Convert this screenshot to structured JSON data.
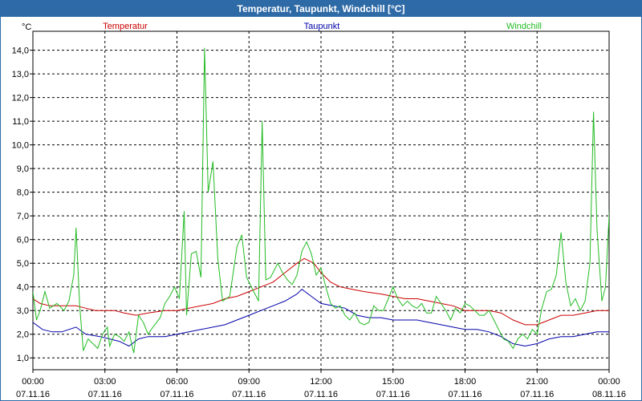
{
  "window": {
    "title": "Temperatur, Taupunkt, Windchill [°C]"
  },
  "colors": {
    "title_bg": "#2e6aa6",
    "temperatur": "#cc0000",
    "taupunkt": "#0000aa",
    "windchill": "#22bb22"
  },
  "chart_data": {
    "type": "line",
    "title": "Temperatur, Taupunkt, Windchill [°C]",
    "ylabel": "°C",
    "ylim": [
      0.5,
      14.8
    ],
    "xlim": [
      0,
      24
    ],
    "grid": true,
    "legend_placement": "top",
    "y_ticks": [
      {
        "value": 1,
        "label": "1,0"
      },
      {
        "value": 2,
        "label": "2,0"
      },
      {
        "value": 3,
        "label": "3,0"
      },
      {
        "value": 4,
        "label": "4,0"
      },
      {
        "value": 5,
        "label": "5,0"
      },
      {
        "value": 6,
        "label": "6,0"
      },
      {
        "value": 7,
        "label": "7,0"
      },
      {
        "value": 8,
        "label": "8,0"
      },
      {
        "value": 9,
        "label": "9,0"
      },
      {
        "value": 10,
        "label": "10,0"
      },
      {
        "value": 11,
        "label": "11,0"
      },
      {
        "value": 12,
        "label": "12,0"
      },
      {
        "value": 13,
        "label": "13,0"
      },
      {
        "value": 14,
        "label": "14,0"
      }
    ],
    "x_ticks": [
      {
        "value": 0,
        "time": "00:00",
        "date": "07.11.16"
      },
      {
        "value": 3,
        "time": "03:00",
        "date": "07.11.16"
      },
      {
        "value": 6,
        "time": "06:00",
        "date": "07.11.16"
      },
      {
        "value": 9,
        "time": "09:00",
        "date": "07.11.16"
      },
      {
        "value": 12,
        "time": "12:00",
        "date": "07.11.16"
      },
      {
        "value": 15,
        "time": "15:00",
        "date": "07.11.16"
      },
      {
        "value": 18,
        "time": "18:00",
        "date": "07.11.16"
      },
      {
        "value": 21,
        "time": "21:00",
        "date": "07.11.16"
      },
      {
        "value": 24,
        "time": "00:00",
        "date": "08.11.16"
      }
    ],
    "series": [
      {
        "name": "Temperatur",
        "color": "#cc0000",
        "points": [
          [
            0,
            3.5
          ],
          [
            0.3,
            3.3
          ],
          [
            0.7,
            3.2
          ],
          [
            1.2,
            3.2
          ],
          [
            1.8,
            3.2
          ],
          [
            2.2,
            3.1
          ],
          [
            2.6,
            3.0
          ],
          [
            3.0,
            3.0
          ],
          [
            3.4,
            3.0
          ],
          [
            3.8,
            2.9
          ],
          [
            4.3,
            2.8
          ],
          [
            4.8,
            2.9
          ],
          [
            5.5,
            3.0
          ],
          [
            6.0,
            3.0
          ],
          [
            6.5,
            3.1
          ],
          [
            7.0,
            3.2
          ],
          [
            7.5,
            3.3
          ],
          [
            8.0,
            3.5
          ],
          [
            8.5,
            3.6
          ],
          [
            9.0,
            3.8
          ],
          [
            9.5,
            4.0
          ],
          [
            10.0,
            4.2
          ],
          [
            10.5,
            4.6
          ],
          [
            11.0,
            5.0
          ],
          [
            11.3,
            5.2
          ],
          [
            11.7,
            5.0
          ],
          [
            12.0,
            4.6
          ],
          [
            12.4,
            4.2
          ],
          [
            12.8,
            4.0
          ],
          [
            13.3,
            3.9
          ],
          [
            13.8,
            3.8
          ],
          [
            14.5,
            3.7
          ],
          [
            15.0,
            3.6
          ],
          [
            15.5,
            3.5
          ],
          [
            16.0,
            3.5
          ],
          [
            16.5,
            3.4
          ],
          [
            17.0,
            3.3
          ],
          [
            17.5,
            3.2
          ],
          [
            18.0,
            3.0
          ],
          [
            18.5,
            3.0
          ],
          [
            19.0,
            3.0
          ],
          [
            19.5,
            2.9
          ],
          [
            20.0,
            2.6
          ],
          [
            20.5,
            2.4
          ],
          [
            21.0,
            2.4
          ],
          [
            21.5,
            2.6
          ],
          [
            22.0,
            2.8
          ],
          [
            22.5,
            2.8
          ],
          [
            23.0,
            2.9
          ],
          [
            23.5,
            3.0
          ],
          [
            24.0,
            3.0
          ]
        ]
      },
      {
        "name": "Taupunkt",
        "color": "#0000aa",
        "points": [
          [
            0,
            2.5
          ],
          [
            0.4,
            2.2
          ],
          [
            0.8,
            2.1
          ],
          [
            1.2,
            2.1
          ],
          [
            1.8,
            2.3
          ],
          [
            2.2,
            2.0
          ],
          [
            2.8,
            1.9
          ],
          [
            3.2,
            1.8
          ],
          [
            3.6,
            1.7
          ],
          [
            4.0,
            1.5
          ],
          [
            4.4,
            1.8
          ],
          [
            4.8,
            1.9
          ],
          [
            5.5,
            1.9
          ],
          [
            6.0,
            2.0
          ],
          [
            6.5,
            2.1
          ],
          [
            7.0,
            2.2
          ],
          [
            7.5,
            2.3
          ],
          [
            8.0,
            2.4
          ],
          [
            8.5,
            2.6
          ],
          [
            9.0,
            2.8
          ],
          [
            9.5,
            3.0
          ],
          [
            10.0,
            3.2
          ],
          [
            10.5,
            3.4
          ],
          [
            11.0,
            3.7
          ],
          [
            11.2,
            3.9
          ],
          [
            11.6,
            3.6
          ],
          [
            12.0,
            3.3
          ],
          [
            12.5,
            3.2
          ],
          [
            13.0,
            3.1
          ],
          [
            13.5,
            2.8
          ],
          [
            14.0,
            2.7
          ],
          [
            14.5,
            2.7
          ],
          [
            15.0,
            2.6
          ],
          [
            15.5,
            2.6
          ],
          [
            16.0,
            2.6
          ],
          [
            16.5,
            2.5
          ],
          [
            17.0,
            2.4
          ],
          [
            17.5,
            2.3
          ],
          [
            18.0,
            2.2
          ],
          [
            18.5,
            2.2
          ],
          [
            19.0,
            2.1
          ],
          [
            19.5,
            1.9
          ],
          [
            20.0,
            1.6
          ],
          [
            20.5,
            1.5
          ],
          [
            21.0,
            1.6
          ],
          [
            21.5,
            1.8
          ],
          [
            22.0,
            1.9
          ],
          [
            22.5,
            1.9
          ],
          [
            23.0,
            2.0
          ],
          [
            23.5,
            2.1
          ],
          [
            24.0,
            2.1
          ]
        ]
      },
      {
        "name": "Windchill",
        "color": "#22bb22",
        "points": [
          [
            0,
            3.8
          ],
          [
            0.15,
            2.6
          ],
          [
            0.3,
            3.0
          ],
          [
            0.5,
            3.8
          ],
          [
            0.7,
            3.1
          ],
          [
            1.0,
            3.3
          ],
          [
            1.3,
            3.0
          ],
          [
            1.5,
            3.4
          ],
          [
            1.7,
            4.5
          ],
          [
            1.8,
            6.5
          ],
          [
            1.95,
            3.2
          ],
          [
            2.1,
            1.3
          ],
          [
            2.3,
            1.8
          ],
          [
            2.5,
            1.6
          ],
          [
            2.7,
            1.4
          ],
          [
            2.9,
            2.0
          ],
          [
            3.1,
            2.3
          ],
          [
            3.2,
            1.5
          ],
          [
            3.4,
            2.0
          ],
          [
            3.6,
            1.9
          ],
          [
            3.8,
            1.7
          ],
          [
            4.0,
            2.1
          ],
          [
            4.2,
            1.2
          ],
          [
            4.4,
            2.8
          ],
          [
            4.6,
            2.5
          ],
          [
            4.8,
            2.0
          ],
          [
            5.0,
            2.3
          ],
          [
            5.3,
            2.7
          ],
          [
            5.5,
            3.3
          ],
          [
            5.7,
            3.6
          ],
          [
            5.9,
            4.0
          ],
          [
            6.1,
            3.5
          ],
          [
            6.3,
            7.2
          ],
          [
            6.4,
            2.8
          ],
          [
            6.6,
            5.4
          ],
          [
            6.8,
            5.5
          ],
          [
            7.0,
            4.4
          ],
          [
            7.15,
            14.1
          ],
          [
            7.3,
            8.0
          ],
          [
            7.5,
            9.3
          ],
          [
            7.7,
            5.2
          ],
          [
            7.9,
            3.4
          ],
          [
            8.2,
            3.6
          ],
          [
            8.5,
            5.7
          ],
          [
            8.7,
            6.2
          ],
          [
            8.9,
            4.4
          ],
          [
            9.1,
            4.0
          ],
          [
            9.2,
            3.8
          ],
          [
            9.4,
            3.4
          ],
          [
            9.55,
            11.0
          ],
          [
            9.7,
            4.3
          ],
          [
            9.9,
            4.4
          ],
          [
            10.2,
            5.0
          ],
          [
            10.4,
            4.6
          ],
          [
            10.6,
            4.3
          ],
          [
            10.8,
            4.1
          ],
          [
            11.0,
            4.5
          ],
          [
            11.2,
            5.5
          ],
          [
            11.4,
            5.9
          ],
          [
            11.6,
            5.4
          ],
          [
            11.8,
            4.5
          ],
          [
            12.0,
            4.8
          ],
          [
            12.2,
            4.0
          ],
          [
            12.4,
            3.3
          ],
          [
            12.6,
            3.1
          ],
          [
            12.8,
            3.2
          ],
          [
            13.0,
            2.8
          ],
          [
            13.2,
            2.6
          ],
          [
            13.4,
            2.9
          ],
          [
            13.6,
            2.5
          ],
          [
            13.8,
            2.4
          ],
          [
            14.0,
            2.5
          ],
          [
            14.2,
            3.2
          ],
          [
            14.4,
            3.0
          ],
          [
            14.6,
            3.0
          ],
          [
            14.8,
            3.5
          ],
          [
            15.0,
            4.0
          ],
          [
            15.2,
            3.5
          ],
          [
            15.4,
            3.2
          ],
          [
            15.6,
            3.4
          ],
          [
            15.8,
            3.2
          ],
          [
            16.0,
            3.1
          ],
          [
            16.2,
            3.3
          ],
          [
            16.4,
            2.9
          ],
          [
            16.6,
            2.9
          ],
          [
            16.8,
            3.6
          ],
          [
            17.0,
            3.3
          ],
          [
            17.2,
            3.0
          ],
          [
            17.4,
            2.6
          ],
          [
            17.6,
            3.1
          ],
          [
            17.8,
            2.9
          ],
          [
            18.0,
            3.3
          ],
          [
            18.2,
            3.2
          ],
          [
            18.4,
            3.0
          ],
          [
            18.6,
            2.8
          ],
          [
            18.8,
            2.8
          ],
          [
            19.0,
            3.0
          ],
          [
            19.2,
            2.6
          ],
          [
            19.4,
            2.2
          ],
          [
            19.6,
            1.8
          ],
          [
            19.8,
            1.7
          ],
          [
            20.0,
            1.4
          ],
          [
            20.2,
            1.8
          ],
          [
            20.4,
            2.0
          ],
          [
            20.6,
            1.8
          ],
          [
            20.8,
            2.2
          ],
          [
            21.0,
            2.0
          ],
          [
            21.2,
            3.1
          ],
          [
            21.4,
            3.8
          ],
          [
            21.6,
            3.9
          ],
          [
            21.8,
            4.5
          ],
          [
            22.0,
            6.3
          ],
          [
            22.2,
            4.2
          ],
          [
            22.4,
            3.2
          ],
          [
            22.6,
            3.5
          ],
          [
            22.8,
            3.0
          ],
          [
            23.0,
            3.4
          ],
          [
            23.2,
            5.0
          ],
          [
            23.35,
            11.4
          ],
          [
            23.5,
            6.4
          ],
          [
            23.7,
            3.4
          ],
          [
            23.85,
            4.0
          ],
          [
            24.0,
            7.0
          ],
          [
            24.15,
            9.8
          ],
          [
            24.3,
            6.2
          ],
          [
            24.45,
            3.7
          ],
          [
            24.6,
            3.6
          ],
          [
            24.75,
            3.8
          ],
          [
            24.85,
            4.9
          ]
        ]
      }
    ]
  }
}
